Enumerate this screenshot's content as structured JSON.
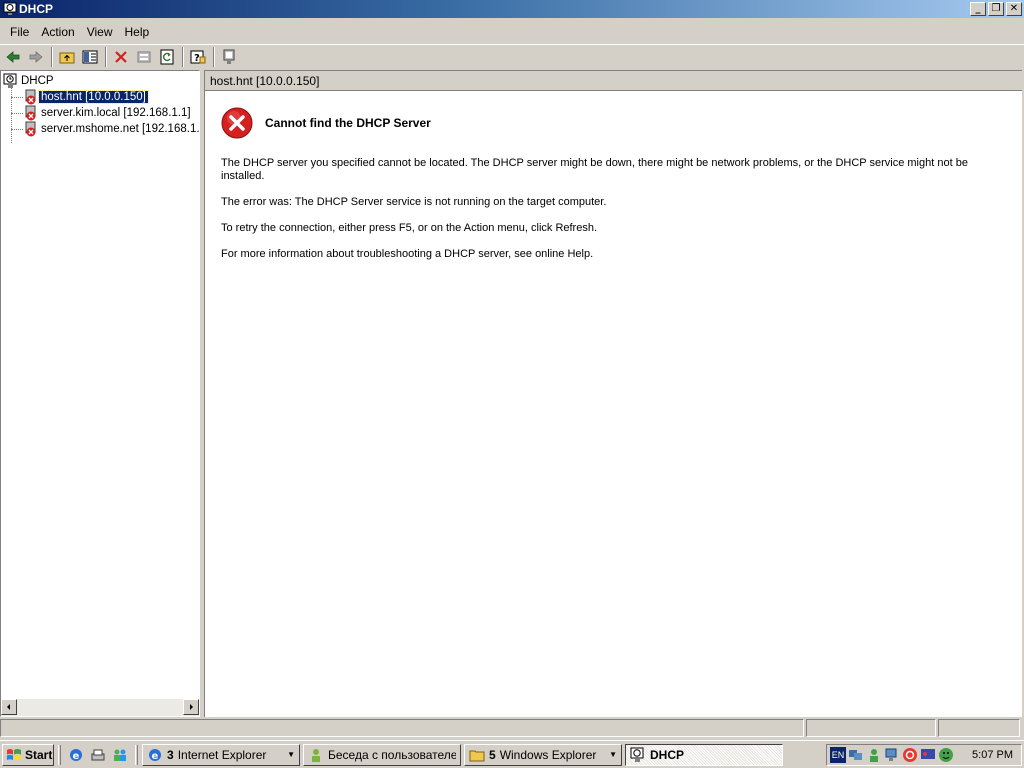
{
  "window": {
    "title": "DHCP",
    "minimize": "_",
    "restore": "❐",
    "close": "✕"
  },
  "menu": [
    {
      "label": "File"
    },
    {
      "label": "Action"
    },
    {
      "label": "View"
    },
    {
      "label": "Help"
    }
  ],
  "toolbar": {
    "icons": [
      "back-arrow-icon",
      "forward-arrow-icon",
      "up-folder-icon",
      "show-hide-tree-icon",
      "delete-icon",
      "properties-icon",
      "refresh-icon",
      "help-icon",
      "server-icon"
    ]
  },
  "tree": {
    "root": "DHCP",
    "items": [
      {
        "label": "host.hnt [10.0.0.150]",
        "selected": true
      },
      {
        "label": "server.kim.local [192.168.1.1]"
      },
      {
        "label": "server.mshome.net [192.168.1."
      }
    ]
  },
  "right_pane": {
    "header": "host.hnt [10.0.0.150]",
    "error_title": "Cannot find the DHCP Server",
    "para1": "The DHCP server you specified cannot be located. The DHCP server might be down, there might be network problems, or the DHCP service might not be installed.",
    "para2": "The error was:  The DHCP Server service is not running on the target computer.",
    "para3": "To retry the connection, either press F5, or on the Action menu, click Refresh.",
    "para4": "For more information about troubleshooting a DHCP server, see online Help."
  },
  "taskbar": {
    "start": "Start",
    "tasks": [
      {
        "count": "3",
        "label": "Internet Explorer"
      },
      {
        "label": "Беседа с пользователе..."
      },
      {
        "count": "5",
        "label": "Windows Explorer"
      },
      {
        "label": "DHCP"
      }
    ],
    "tray": {
      "lang": "EN",
      "clock": "5:07 PM"
    }
  },
  "colors": {
    "title_active": "#0a246a",
    "selection": "#0a246a",
    "error_red": "#d42020"
  }
}
